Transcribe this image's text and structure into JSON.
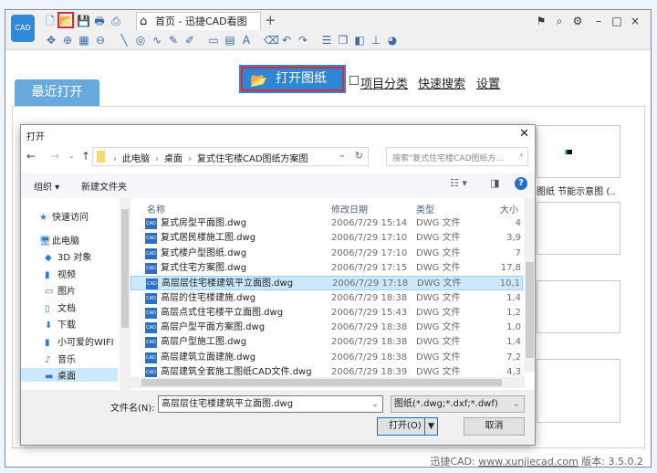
{
  "app": {
    "logo_text": "CAD",
    "tab_title": "首页 - 迅捷CAD看图",
    "new_tab": "+",
    "window_controls": [
      "minimize-icon",
      "maximize-icon",
      "close-icon"
    ],
    "quick_icons": [
      "new-file-icon",
      "open-file-icon",
      "save-icon",
      "print-icon",
      "export-icon"
    ],
    "toolbar_icons": [
      "pan-icon",
      "zoom-window-icon",
      "zoom-extents-icon",
      "zoom-icon",
      "line-icon",
      "circle-icon",
      "curve-icon",
      "pencil-icon",
      "text-edit-icon",
      "frame-icon",
      "image-icon",
      "text-icon",
      "eraser-icon",
      "undo-icon",
      "redo-icon",
      "layer-icon",
      "3d-box-icon",
      "3d-view-icon",
      "coordinate-icon",
      "color-wheel-icon"
    ],
    "right_icons": [
      "flag-icon",
      "search-icon",
      "gear-icon"
    ]
  },
  "main": {
    "open_button": "打开图纸",
    "project_category": "项目分类",
    "quick_search": "快速搜索",
    "settings": "设置",
    "recent_tab": "最近打开",
    "thumb_label": "图纸 节能示意图 (..",
    "footer_brand": "迅捷CAD: ",
    "footer_url": "www.xunjiecad.com",
    "footer_version": " 版本: 3.5.0.2"
  },
  "dialog": {
    "title": "打开",
    "close": "✕",
    "breadcrumb": [
      "此电脑",
      "桌面",
      "复式住宅楼CAD图纸方案图"
    ],
    "search_placeholder": "搜索\"复式住宅楼CAD图纸方...",
    "organize": "组织 ▾",
    "new_folder": "新建文件夹",
    "sidebar": [
      {
        "label": "快速访问",
        "icon": "star-icon"
      },
      {
        "label": "此电脑",
        "icon": "computer-icon"
      },
      {
        "label": "3D 对象",
        "icon": "cube-icon"
      },
      {
        "label": "视频",
        "icon": "video-icon"
      },
      {
        "label": "图片",
        "icon": "picture-icon"
      },
      {
        "label": "文档",
        "icon": "document-icon"
      },
      {
        "label": "下载",
        "icon": "download-icon"
      },
      {
        "label": "小可爱的WIFI",
        "icon": "phone-icon"
      },
      {
        "label": "音乐",
        "icon": "music-icon"
      },
      {
        "label": "桌面",
        "icon": "desktop-icon"
      }
    ],
    "columns": [
      "名称",
      "修改日期",
      "类型",
      "大小"
    ],
    "files": [
      {
        "name": "复式房型平面图.dwg",
        "date": "2006/7/29 15:14",
        "type": "DWG 文件",
        "size": "4"
      },
      {
        "name": "复式居民楼施工图.dwg",
        "date": "2006/7/29 17:10",
        "type": "DWG 文件",
        "size": "3,9"
      },
      {
        "name": "复式楼户型图纸.dwg",
        "date": "2006/7/29 17:10",
        "type": "DWG 文件",
        "size": "7"
      },
      {
        "name": "复式住宅方案图.dwg",
        "date": "2006/7/29 17:15",
        "type": "DWG 文件",
        "size": "17,8"
      },
      {
        "name": "高层层住宅楼建筑平立面图.dwg",
        "date": "2006/7/29 17:18",
        "type": "DWG 文件",
        "size": "10,1"
      },
      {
        "name": "高层的住宅楼建施.dwg",
        "date": "2006/7/29 18:38",
        "type": "DWG 文件",
        "size": "1,4"
      },
      {
        "name": "高层点式住宅楼平立面图.dwg",
        "date": "2006/7/29 15:43",
        "type": "DWG 文件",
        "size": "1,2"
      },
      {
        "name": "高层户型平面方案图.dwg",
        "date": "2006/7/29 18:38",
        "type": "DWG 文件",
        "size": "1,0"
      },
      {
        "name": "高层户型施工图.dwg",
        "date": "2006/7/29 18:38",
        "type": "DWG 文件",
        "size": "1,4"
      },
      {
        "name": "高层建筑立面建施.dwg",
        "date": "2006/7/29 18:38",
        "type": "DWG 文件",
        "size": "7,2"
      },
      {
        "name": "高层建筑全套施工图纸CAD文件.dwg",
        "date": "2006/7/29 18:39",
        "type": "DWG 文件",
        "size": "4,3"
      }
    ],
    "selected_index": 4,
    "filename_label": "文件名(N):",
    "filename_value": "高层层住宅楼建筑平立面图.dwg",
    "filter_value": "图纸(*.dwg;*.dxf;*.dwf)",
    "open_button": "打开(O)",
    "cancel_button": "取消"
  }
}
